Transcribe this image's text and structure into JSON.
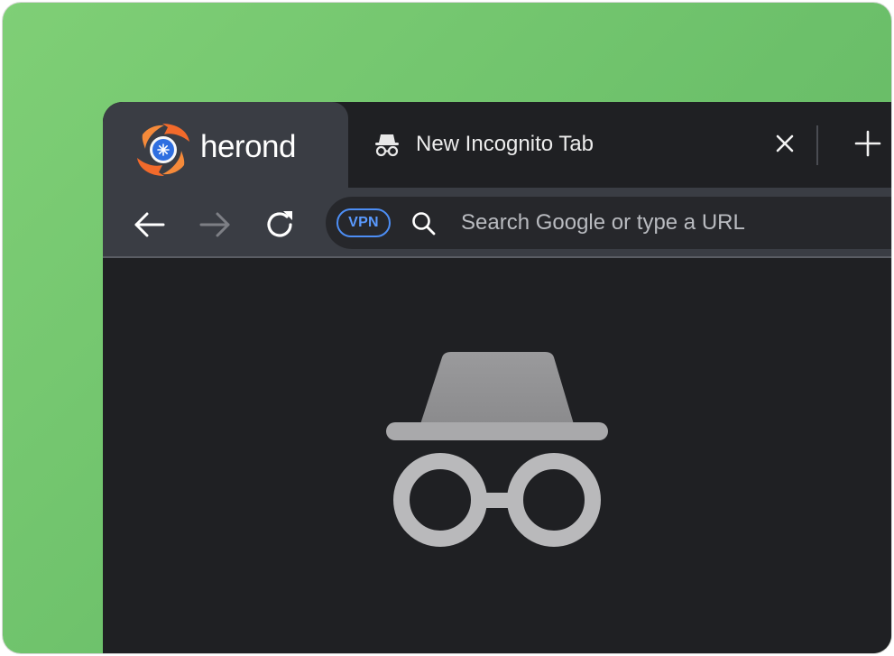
{
  "brand": {
    "name": "herond",
    "logo_icon": "herond-logo-icon"
  },
  "tab": {
    "title": "New Incognito Tab",
    "icon": "incognito-icon",
    "close_icon": "close-icon"
  },
  "new_tab": {
    "icon": "plus-icon"
  },
  "toolbar": {
    "back_icon": "arrow-left-icon",
    "forward_icon": "arrow-right-icon",
    "reload_icon": "reload-icon",
    "vpn_label": "VPN",
    "search_icon": "search-icon",
    "search_placeholder": "Search Google or type a URL"
  },
  "content": {
    "hero_icon": "incognito-icon"
  },
  "colors": {
    "background_green": "#6cc06a",
    "browser_dark": "#1f2023",
    "toolbar_gray": "#3a3d44",
    "vpn_blue": "#4d8ef5",
    "brand_orange": "#f26a2b",
    "brand_blue": "#2f6fe0"
  }
}
